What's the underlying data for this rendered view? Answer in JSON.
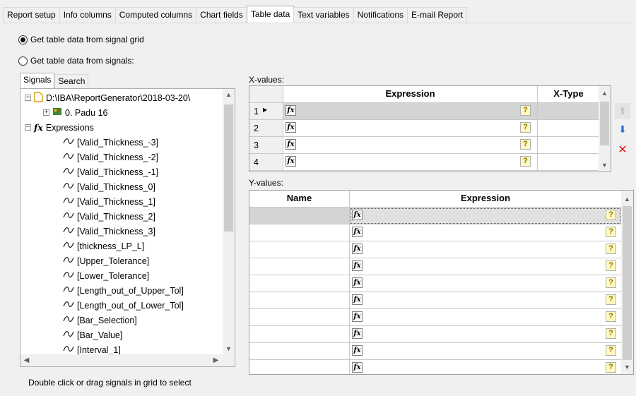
{
  "tabs": [
    "Report setup",
    "Info columns",
    "Computed columns",
    "Chart fields",
    "Table data",
    "Text variables",
    "Notifications",
    "E-mail Report"
  ],
  "active_tab": "Table data",
  "source": {
    "option_grid": "Get table data from signal grid",
    "option_signals": "Get table data from signals:",
    "selected": "grid"
  },
  "left_tabs": [
    "Signals",
    "Search"
  ],
  "tree": {
    "root": "D:\\IBA\\ReportGenerator\\2018-03-20\\",
    "device": "0. Padu 16",
    "expressions_label": "Expressions",
    "signals": [
      "[Valid_Thickness_-3]",
      "[Valid_Thickness_-2]",
      "[Valid_Thickness_-1]",
      "[Valid_Thickness_0]",
      "[Valid_Thickness_1]",
      "[Valid_Thickness_2]",
      "[Valid_Thickness_3]",
      "[thickness_LP_L]",
      "[Upper_Tolerance]",
      "[Lower_Tolerance]",
      "[Length_out_of_Upper_Tol]",
      "[Length_out_of_Lower_Tol]",
      "[Bar_Selection]",
      "[Bar_Value]",
      "[Interval_1]"
    ]
  },
  "hint": "Double click or drag signals in grid to select",
  "x_values": {
    "label": "X-values:",
    "columns": [
      "Expression",
      "X-Type"
    ],
    "rows": [
      "1",
      "2",
      "3",
      "4"
    ]
  },
  "y_values": {
    "label": "Y-values:",
    "columns": [
      "Name",
      "Expression"
    ],
    "row_count": 10
  },
  "icons": {
    "fx": "function-icon",
    "help": "help-icon",
    "move_up": "arrow-up-icon",
    "move_down": "arrow-down-icon",
    "delete": "delete-icon"
  },
  "colors": {
    "selected_row": "#d4d4d4",
    "down_arrow": "#2a6fd6",
    "delete": "#e11111"
  }
}
